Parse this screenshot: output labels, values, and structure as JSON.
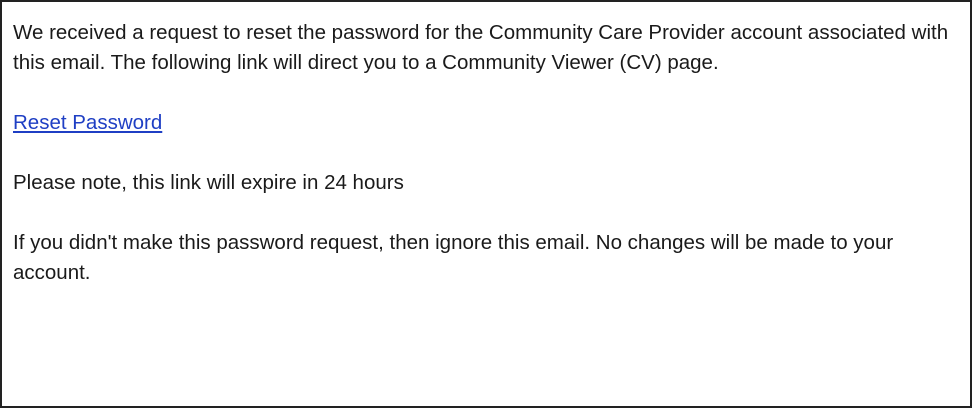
{
  "email": {
    "intro": "We received a request to reset the password for the Community Care Provider account associated with this email. The following link will direct you to a Community Viewer (CV) page.",
    "link_label": "Reset Password",
    "expiry_note": "Please note, this link will expire in 24 hours",
    "disclaimer": "If you didn't make this password request, then ignore this email. No changes will be made to your account."
  },
  "colors": {
    "link": "#1f3fc4",
    "text": "#1a1a1a",
    "border": "#222222",
    "background": "#ffffff"
  }
}
